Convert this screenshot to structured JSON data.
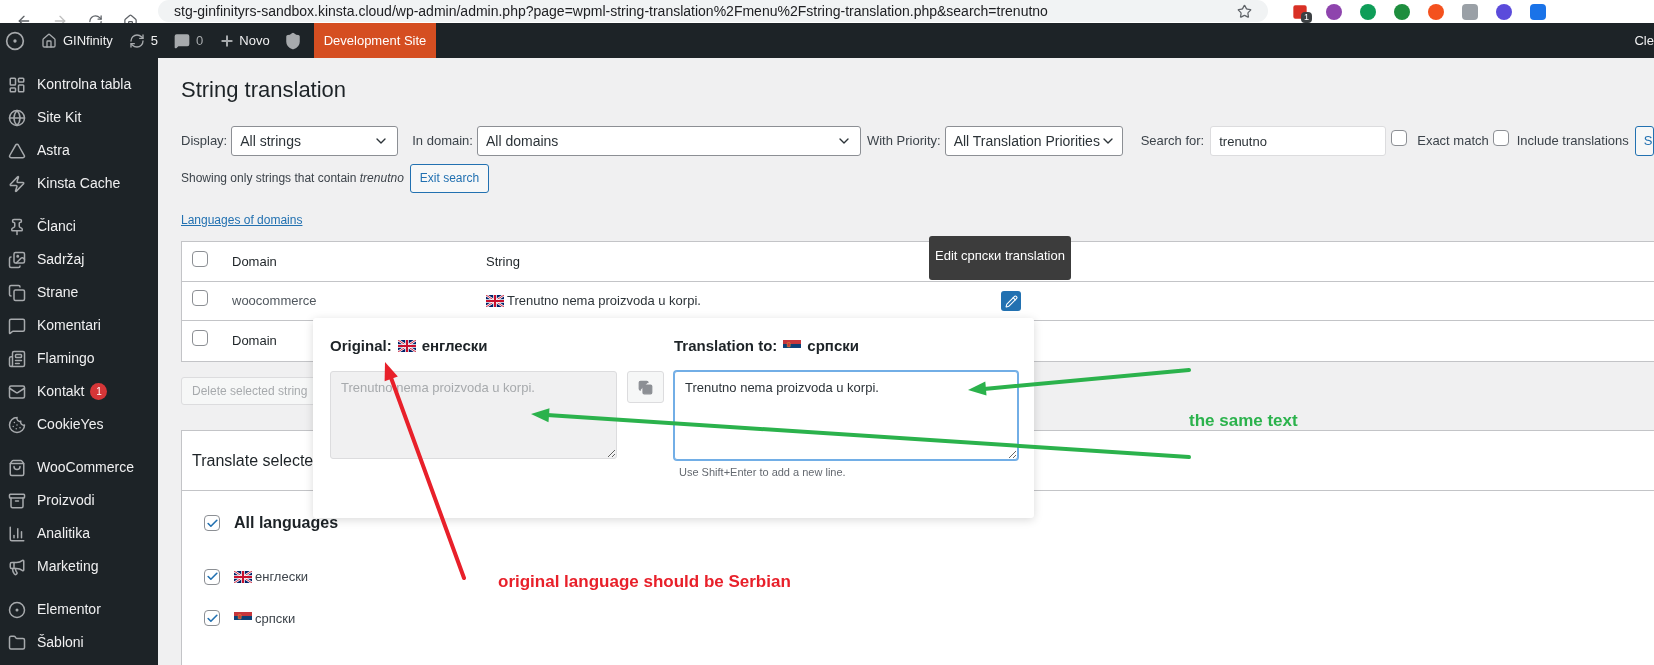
{
  "browser": {
    "url": "stg-ginfinityrs-sandbox.kinsta.cloud/wp-admin/admin.php?page=wpml-string-translation%2Fmenu%2Fstring-translation.php&search=trenutno",
    "extension_badge": "1"
  },
  "admin_bar": {
    "site": "GINfinity",
    "updates": "5",
    "comments": "0",
    "new": "Novo",
    "environment": "Development Site",
    "account": "Cle"
  },
  "sidebar": {
    "groups": [
      [
        {
          "label": "Kontrolna tabla"
        },
        {
          "label": "Site Kit"
        },
        {
          "label": "Astra"
        },
        {
          "label": "Kinsta Cache"
        }
      ],
      [
        {
          "label": "Članci"
        },
        {
          "label": "Sadržaj"
        },
        {
          "label": "Strane"
        },
        {
          "label": "Komentari"
        },
        {
          "label": "Flamingo"
        },
        {
          "label": "Kontakt",
          "badge": "1"
        },
        {
          "label": "CookieYes"
        }
      ],
      [
        {
          "label": "WooCommerce"
        },
        {
          "label": "Proizvodi"
        },
        {
          "label": "Analitika"
        },
        {
          "label": "Marketing"
        }
      ],
      [
        {
          "label": "Elementor"
        },
        {
          "label": "Šabloni"
        }
      ]
    ]
  },
  "page": {
    "title": "String translation",
    "filters": {
      "display_label": "Display:",
      "display_value": "All strings",
      "domain_label": "In domain:",
      "domain_value": "All domains",
      "priority_label": "With Priority:",
      "priority_value": "All Translation Priorities",
      "search_label": "Search for:",
      "search_value": "trenutno",
      "exact_match": {
        "label": "Exact match",
        "checked": false
      },
      "include_translations": {
        "label": "Include translations",
        "checked": false
      },
      "search_button": "S"
    },
    "search_notice": "Showing only strings that contain *trenutno*",
    "exit_button": "Exit search",
    "languages_link": "Languages of domains",
    "table": {
      "header_checked": false,
      "columns": [
        "Domain",
        "String"
      ],
      "rows": [
        {
          "checked": false,
          "domain": "woocommerce",
          "kind": "gb",
          "string": "Trenutno nema proizvoda u korpi."
        }
      ],
      "footer_checked": false,
      "footer": [
        "Domain"
      ]
    },
    "tooltip": "Edit српски translation",
    "delete_button": "Delete selected string",
    "translate_panel": {
      "title": "Translate selecte",
      "all_languages": {
        "label": "All languages",
        "checked": true
      },
      "languages": [
        {
          "label": "енглески",
          "kind": "gb",
          "checked": true
        },
        {
          "label": "српски",
          "kind": "rs",
          "checked": true
        }
      ]
    },
    "editor": {
      "original_label": "Original:",
      "original_language": {
        "label": "енглески",
        "kind": "gb"
      },
      "original_text": "Trenutno nema proizvoda u korpi.",
      "translation_label": "Translation to:",
      "translation_language": {
        "label": "српски",
        "kind": "rs"
      },
      "translation_value": "Trenutno nema proizvoda u korpi.",
      "hint": "Use Shift+Enter to add a new line."
    }
  },
  "annotations": {
    "red_note": "original language should be Serbian",
    "green_note": "the same text"
  }
}
